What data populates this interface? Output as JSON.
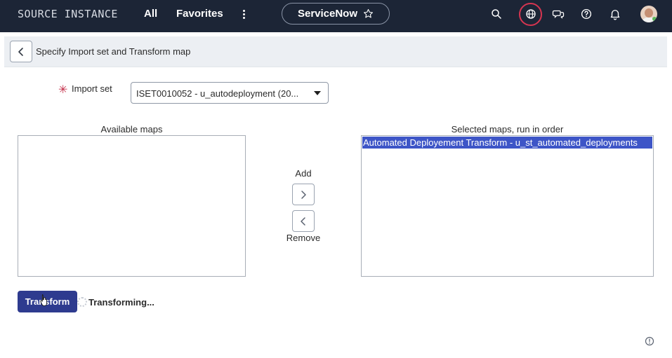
{
  "header": {
    "brand": "SOURCE INSTANCE",
    "nav_all": "All",
    "nav_favorites": "Favorites",
    "context_label": "ServiceNow",
    "icons": [
      "more-vertical-icon",
      "star-icon",
      "search-icon",
      "globe-icon",
      "chat-icon",
      "help-icon",
      "bell-icon"
    ],
    "accent_color": "#d63550"
  },
  "form": {
    "title": "Specify Import set and Transform map",
    "required_marker": "✳",
    "import_set_label": "Import set",
    "import_set_value": "ISET0010052 - u_autodeployment (20..."
  },
  "maps": {
    "available_label": "Available maps",
    "available_items": [],
    "selected_label": "Selected maps, run in order",
    "selected_items": [
      "Automated Deployement Transform - u_st_automated_deployments"
    ],
    "add_label": "Add",
    "remove_label": "Remove"
  },
  "actions": {
    "transform_label": "Transform",
    "status_text": "Transforming...",
    "button_color": "#2e3b8f"
  }
}
